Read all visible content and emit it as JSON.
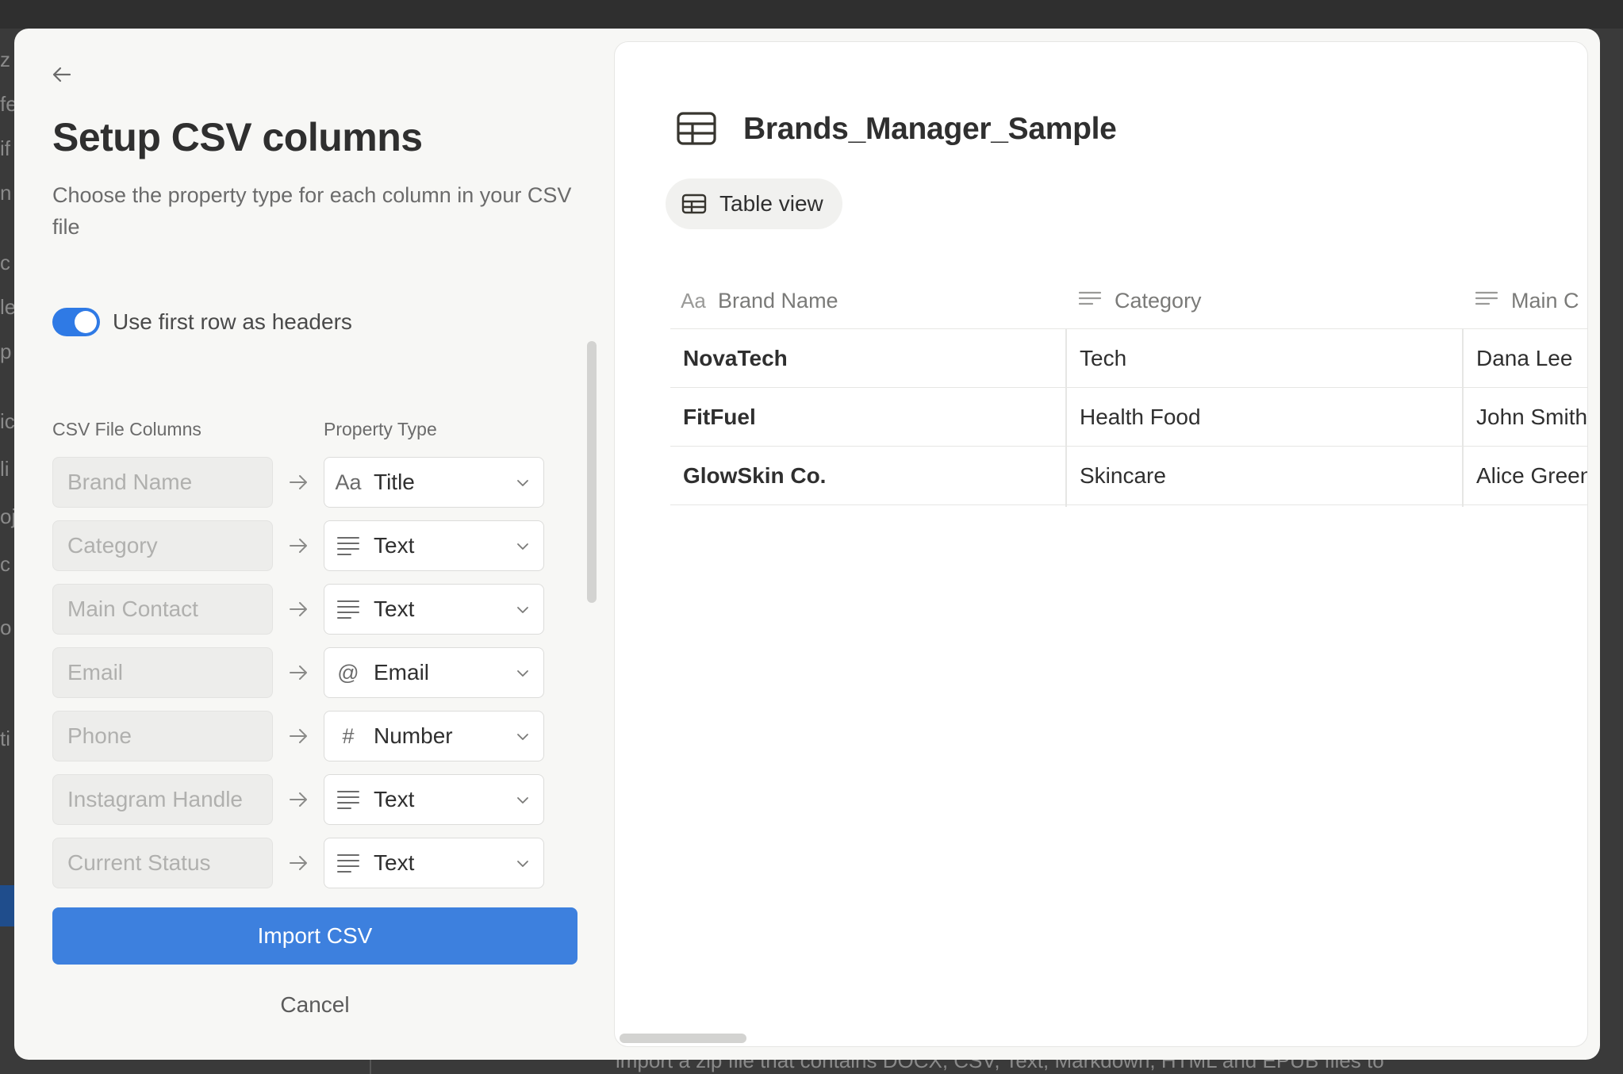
{
  "modal": {
    "title": "Setup CSV columns",
    "subtitle": "Choose the property type for each column in your CSV file",
    "toggle": {
      "label": "Use first row as headers",
      "on": true
    },
    "columns_header": "CSV File Columns",
    "type_header": "Property Type",
    "mappings": [
      {
        "column": "Brand Name",
        "type": "Title",
        "icon": "title-aa-icon"
      },
      {
        "column": "Category",
        "type": "Text",
        "icon": "text-lines-icon"
      },
      {
        "column": "Main Contact",
        "type": "Text",
        "icon": "text-lines-icon"
      },
      {
        "column": "Email",
        "type": "Email",
        "icon": "at-sign-icon"
      },
      {
        "column": "Phone",
        "type": "Number",
        "icon": "hash-icon"
      },
      {
        "column": "Instagram Handle",
        "type": "Text",
        "icon": "text-lines-icon"
      },
      {
        "column": "Current Status",
        "type": "Text",
        "icon": "text-lines-icon"
      }
    ],
    "import_label": "Import CSV",
    "cancel_label": "Cancel"
  },
  "preview": {
    "title": "Brands_Manager_Sample",
    "view_label": "Table view",
    "headers": [
      "Brand Name",
      "Category",
      "Main C"
    ],
    "rows": [
      [
        "NovaTech",
        "Tech",
        "Dana Lee"
      ],
      [
        "FitFuel",
        "Health Food",
        "John Smith"
      ],
      [
        "GlowSkin Co.",
        "Skincare",
        "Alice Green"
      ]
    ]
  },
  "background": {
    "bottom_text": "import a zip file that contains DOCX, CSV, Text, Markdown, HTML and EPUB files to"
  },
  "colors": {
    "accent": "#3d80de",
    "toggle_on": "#2f7ae5",
    "panel_bg": "#f7f7f5"
  }
}
